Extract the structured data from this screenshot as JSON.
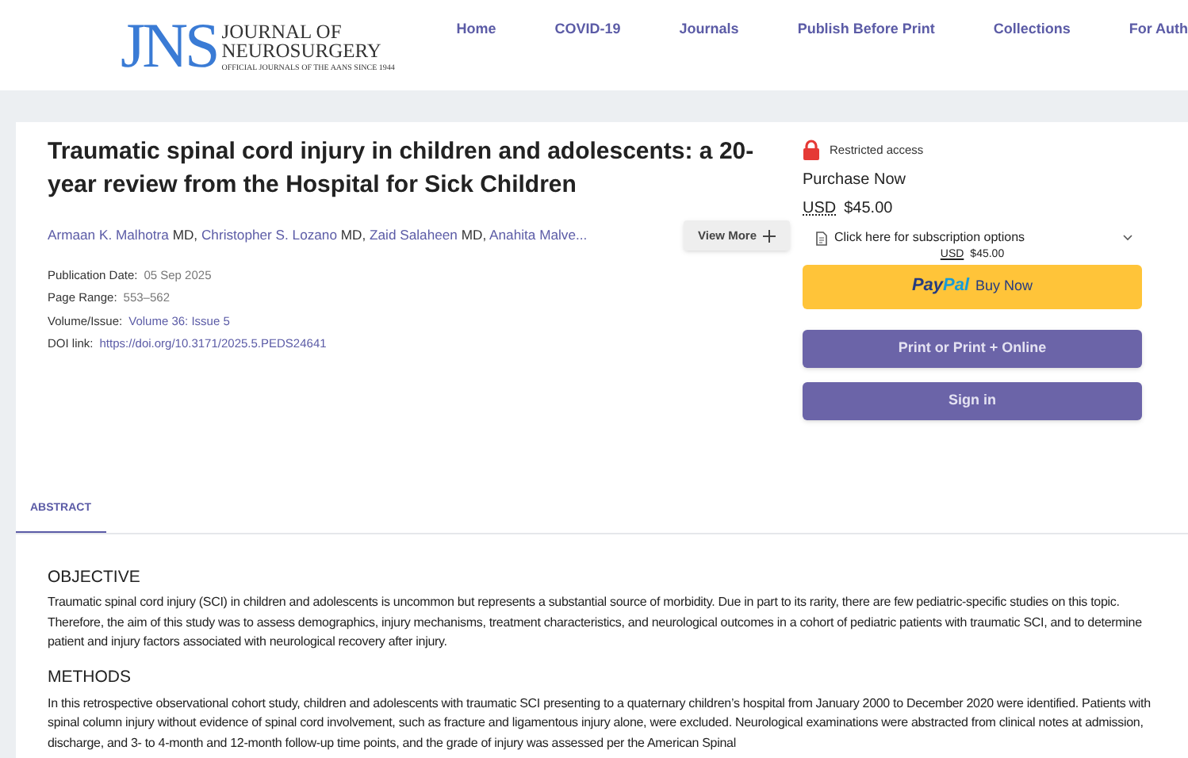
{
  "header": {
    "logo": {
      "mark": "JNS",
      "line1": "JOURNAL OF",
      "line2": "NEUROSURGERY",
      "tagline": "OFFICIAL JOURNALS OF THE AANS SINCE 1944"
    },
    "nav": [
      "Home",
      "COVID-19",
      "Journals",
      "Publish Before Print",
      "Collections",
      "For Auth"
    ]
  },
  "article": {
    "title": "Traumatic spinal cord injury in children and adolescents: a 20-year review from the Hospital for Sick Children",
    "authors": [
      {
        "name": "Armaan K. Malhotra",
        "suffix": "MD,"
      },
      {
        "name": "Christopher S. Lozano",
        "suffix": "MD,"
      },
      {
        "name": "Zaid Salaheen",
        "suffix": "MD,"
      },
      {
        "name": "Anahita Malve..."
      }
    ],
    "view_more": "View More",
    "meta": [
      {
        "label": "Publication Date:",
        "value": "05 Sep 2025",
        "link": false
      },
      {
        "label": "Page Range:",
        "value": "553–562",
        "link": false
      },
      {
        "label": "Volume/Issue:",
        "value": "Volume 36: Issue 5",
        "link": true
      },
      {
        "label": "DOI link:",
        "value": "https://doi.org/10.3171/2025.5.PEDS24641",
        "link": true
      }
    ]
  },
  "purchase": {
    "access": "Restricted access",
    "heading": "Purchase Now",
    "currency": "USD",
    "price": "$45.00",
    "subscription": "Click here for subscription options",
    "sub_currency": "USD",
    "sub_price": "$45.00",
    "paypal": {
      "pay": "Pay",
      "pal": "Pal",
      "label": "Buy Now"
    },
    "buttons": [
      "Print or Print + Online",
      "Sign in"
    ]
  },
  "tabs": [
    {
      "label": "ABSTRACT",
      "selected": true
    }
  ],
  "abstract": [
    {
      "heading": "OBJECTIVE",
      "text": "Traumatic spinal cord injury (SCI) in children and adolescents is uncommon but represents a substantial source of morbidity. Due in part to its rarity, there are few pediatric-specific studies on this topic. Therefore, the aim of this study was to assess demographics, injury mechanisms, treatment characteristics, and neurological outcomes in a cohort of pediatric patients with traumatic SCI, and to determine patient and injury factors associated with neurological recovery after injury."
    },
    {
      "heading": "METHODS",
      "text": "In this retrospective observational cohort study, children and adolescents with traumatic SCI presenting to a quaternary children’s hospital from January 2000 to December 2020 were identified. Patients with spinal column injury without evidence of spinal cord involvement, such as fracture and ligamentous injury alone, were excluded. Neurological examinations were abstracted from clinical notes at admission, discharge, and 3- to 4-month and 12-month follow-up time points, and the grade of injury was assessed per the American Spinal"
    }
  ]
}
